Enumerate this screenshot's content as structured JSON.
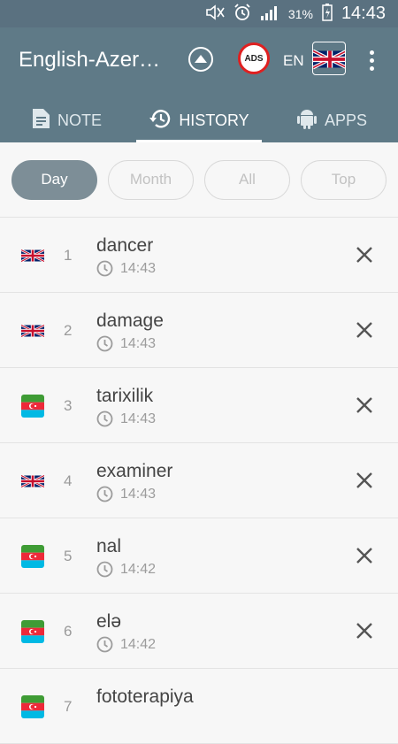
{
  "status_bar": {
    "battery": "31%",
    "time": "14:43"
  },
  "toolbar": {
    "title": "English-Azer…",
    "ads_label": "ADS",
    "lang_code": "EN",
    "flag": "uk-flag-icon"
  },
  "tabs": [
    {
      "label": "NOTE",
      "icon": "note-icon",
      "active": false
    },
    {
      "label": "HISTORY",
      "icon": "history-icon",
      "active": true
    },
    {
      "label": "APPS",
      "icon": "android-icon",
      "active": false
    }
  ],
  "filters": [
    {
      "label": "Day",
      "active": true
    },
    {
      "label": "Month",
      "active": false
    },
    {
      "label": "All",
      "active": false
    },
    {
      "label": "Top",
      "active": false
    }
  ],
  "history": [
    {
      "num": "1",
      "word": "dancer",
      "time": "14:43",
      "flag": "uk"
    },
    {
      "num": "2",
      "word": "damage",
      "time": "14:43",
      "flag": "uk"
    },
    {
      "num": "3",
      "word": "tarixilik",
      "time": "14:43",
      "flag": "az"
    },
    {
      "num": "4",
      "word": "examiner",
      "time": "14:43",
      "flag": "uk"
    },
    {
      "num": "5",
      "word": "nal",
      "time": "14:42",
      "flag": "az"
    },
    {
      "num": "6",
      "word": "elə",
      "time": "14:42",
      "flag": "az"
    },
    {
      "num": "7",
      "word": "fototerapiya",
      "time": "",
      "flag": "az"
    }
  ],
  "colors": {
    "toolbar": "#5f7a87",
    "status_bar": "#5a7180",
    "active_chip": "#7d8e97",
    "ads_ring": "#e02020"
  }
}
